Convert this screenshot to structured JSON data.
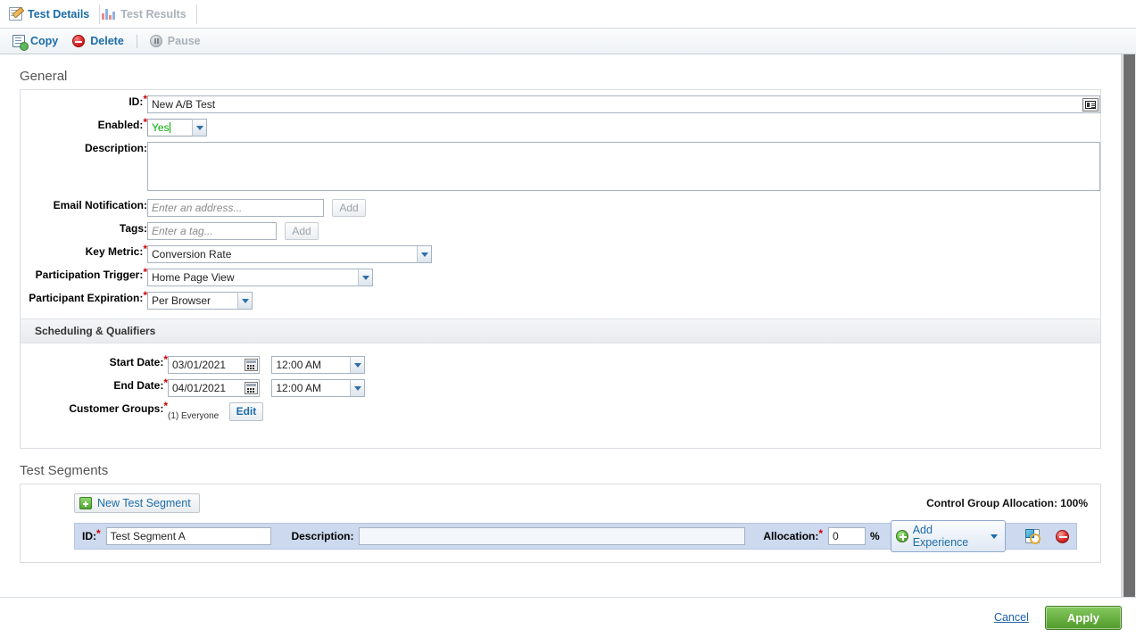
{
  "tabs": [
    {
      "label": "Test Details",
      "icon": "document-edit-icon",
      "active": true
    },
    {
      "label": "Test Results",
      "icon": "bar-chart-icon",
      "active": false
    }
  ],
  "toolbar": {
    "copy_label": "Copy",
    "delete_label": "Delete",
    "pause_label": "Pause"
  },
  "general": {
    "heading": "General",
    "id": {
      "label": "ID:",
      "value": "New A/B Test",
      "required": true
    },
    "enabled": {
      "label": "Enabled:",
      "value": "Yes",
      "required": true
    },
    "description": {
      "label": "Description:",
      "value": "",
      "required": false
    },
    "email_notification": {
      "label": "Email Notification:",
      "placeholder": "Enter an address...",
      "value": "",
      "add_label": "Add"
    },
    "tags": {
      "label": "Tags:",
      "placeholder": "Enter a tag...",
      "value": "",
      "add_label": "Add"
    },
    "key_metric": {
      "label": "Key Metric:",
      "value": "Conversion Rate",
      "required": true
    },
    "participation_trigger": {
      "label": "Participation Trigger:",
      "value": "Home Page View",
      "required": true
    },
    "participant_expiration": {
      "label": "Participant Expiration:",
      "value": "Per Browser",
      "required": true
    }
  },
  "scheduling": {
    "heading": "Scheduling & Qualifiers",
    "start_date": {
      "label": "Start Date:",
      "date": "03/01/2021",
      "time": "12:00 AM",
      "required": true
    },
    "end_date": {
      "label": "End Date:",
      "date": "04/01/2021",
      "time": "12:00 AM",
      "required": true
    },
    "customer_groups": {
      "label": "Customer Groups:",
      "value": "(1) Everyone",
      "edit_label": "Edit",
      "required": true
    }
  },
  "test_segments": {
    "heading": "Test Segments",
    "new_segment_label": "New Test Segment",
    "control_group_allocation": "Control Group Allocation: 100%",
    "row": {
      "id_label": "ID:",
      "id_value": "Test Segment A",
      "description_label": "Description:",
      "description_value": "",
      "allocation_label": "Allocation:",
      "allocation_value": "0",
      "percent_symbol": "%",
      "add_experience_label": "Add Experience",
      "preview_icon": "preview-search-icon",
      "remove_icon": "remove-minus-circle-icon"
    }
  },
  "footer": {
    "cancel_label": "Cancel",
    "apply_label": "Apply"
  },
  "colors": {
    "link": "#1b6ca8",
    "required": "#cc0000",
    "apply_green": "#4f9a2a",
    "segment_row_blue": "#ccd9ef"
  }
}
